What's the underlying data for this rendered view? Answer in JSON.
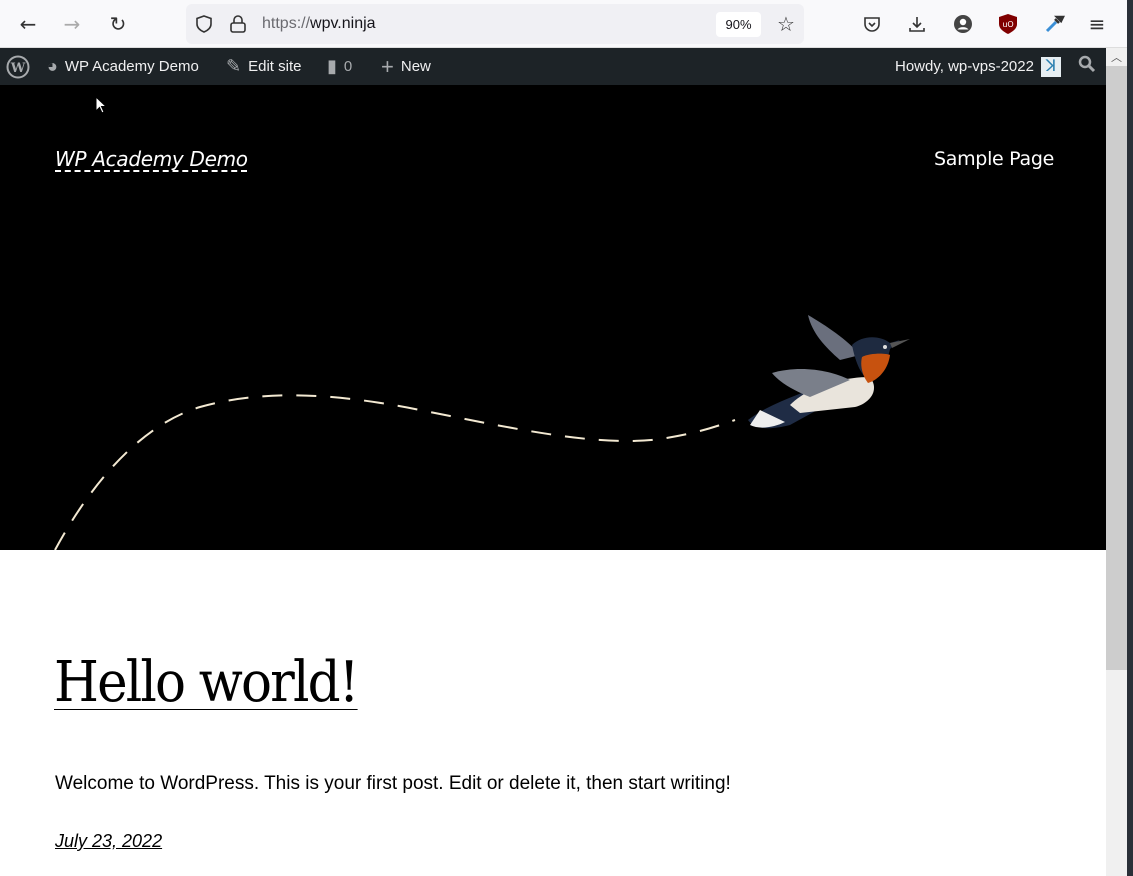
{
  "browser": {
    "url_protocol": "https://",
    "url_host": "wpv.ninja",
    "zoom": "90%",
    "icons": [
      "back-icon",
      "forward-icon",
      "reload-icon",
      "shield-icon",
      "lock-icon",
      "star-icon",
      "pocket-icon",
      "download-icon",
      "account-icon",
      "ublock-icon",
      "eyedropper-icon",
      "menu-icon"
    ]
  },
  "adminbar": {
    "site": "WP Academy Demo",
    "edit": "Edit site",
    "comments": "0",
    "new": "New",
    "howdy": "Howdy, wp-vps-2022"
  },
  "header": {
    "site_title": "WP Academy Demo",
    "nav": [
      "Sample Page"
    ]
  },
  "post": {
    "title": "Hello world!",
    "excerpt": "Welcome to WordPress. This is your first post. Edit or delete it, then start writing!",
    "date": "July 23, 2022"
  },
  "colors": {
    "adminbar": "#1d2327",
    "hero": "#000000",
    "dash": "#f3e9d2"
  }
}
